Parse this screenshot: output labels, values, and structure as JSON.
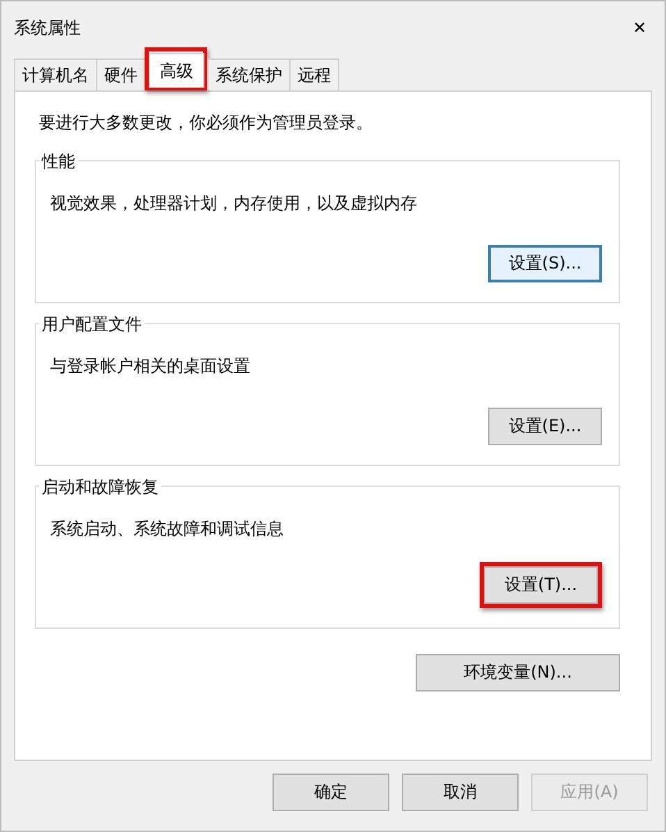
{
  "window": {
    "title": "系统属性",
    "close": "✕"
  },
  "tabs": [
    {
      "label": "计算机名",
      "selected": false,
      "highlighted": false
    },
    {
      "label": "硬件",
      "selected": false,
      "highlighted": false
    },
    {
      "label": "高级",
      "selected": true,
      "highlighted": true
    },
    {
      "label": "系统保护",
      "selected": false,
      "highlighted": false
    },
    {
      "label": "远程",
      "selected": false,
      "highlighted": false
    }
  ],
  "notice": "要进行大多数更改，你必须作为管理员登录。",
  "groups": [
    {
      "title": "性能",
      "description": "视觉效果，处理器计划，内存使用，以及虚拟内存",
      "button": {
        "label": "设置(S)...",
        "focused": true,
        "highlighted": false
      }
    },
    {
      "title": "用户配置文件",
      "description": "与登录帐户相关的桌面设置",
      "button": {
        "label": "设置(E)...",
        "focused": false,
        "highlighted": false
      }
    },
    {
      "title": "启动和故障恢复",
      "description": "系统启动、系统故障和调试信息",
      "button": {
        "label": "设置(T)...",
        "focused": false,
        "highlighted": true
      }
    }
  ],
  "env_button": "环境变量(N)...",
  "buttons": [
    {
      "label": "确定",
      "disabled": false
    },
    {
      "label": "取消",
      "disabled": false
    },
    {
      "label": "应用(A)",
      "disabled": true
    }
  ]
}
